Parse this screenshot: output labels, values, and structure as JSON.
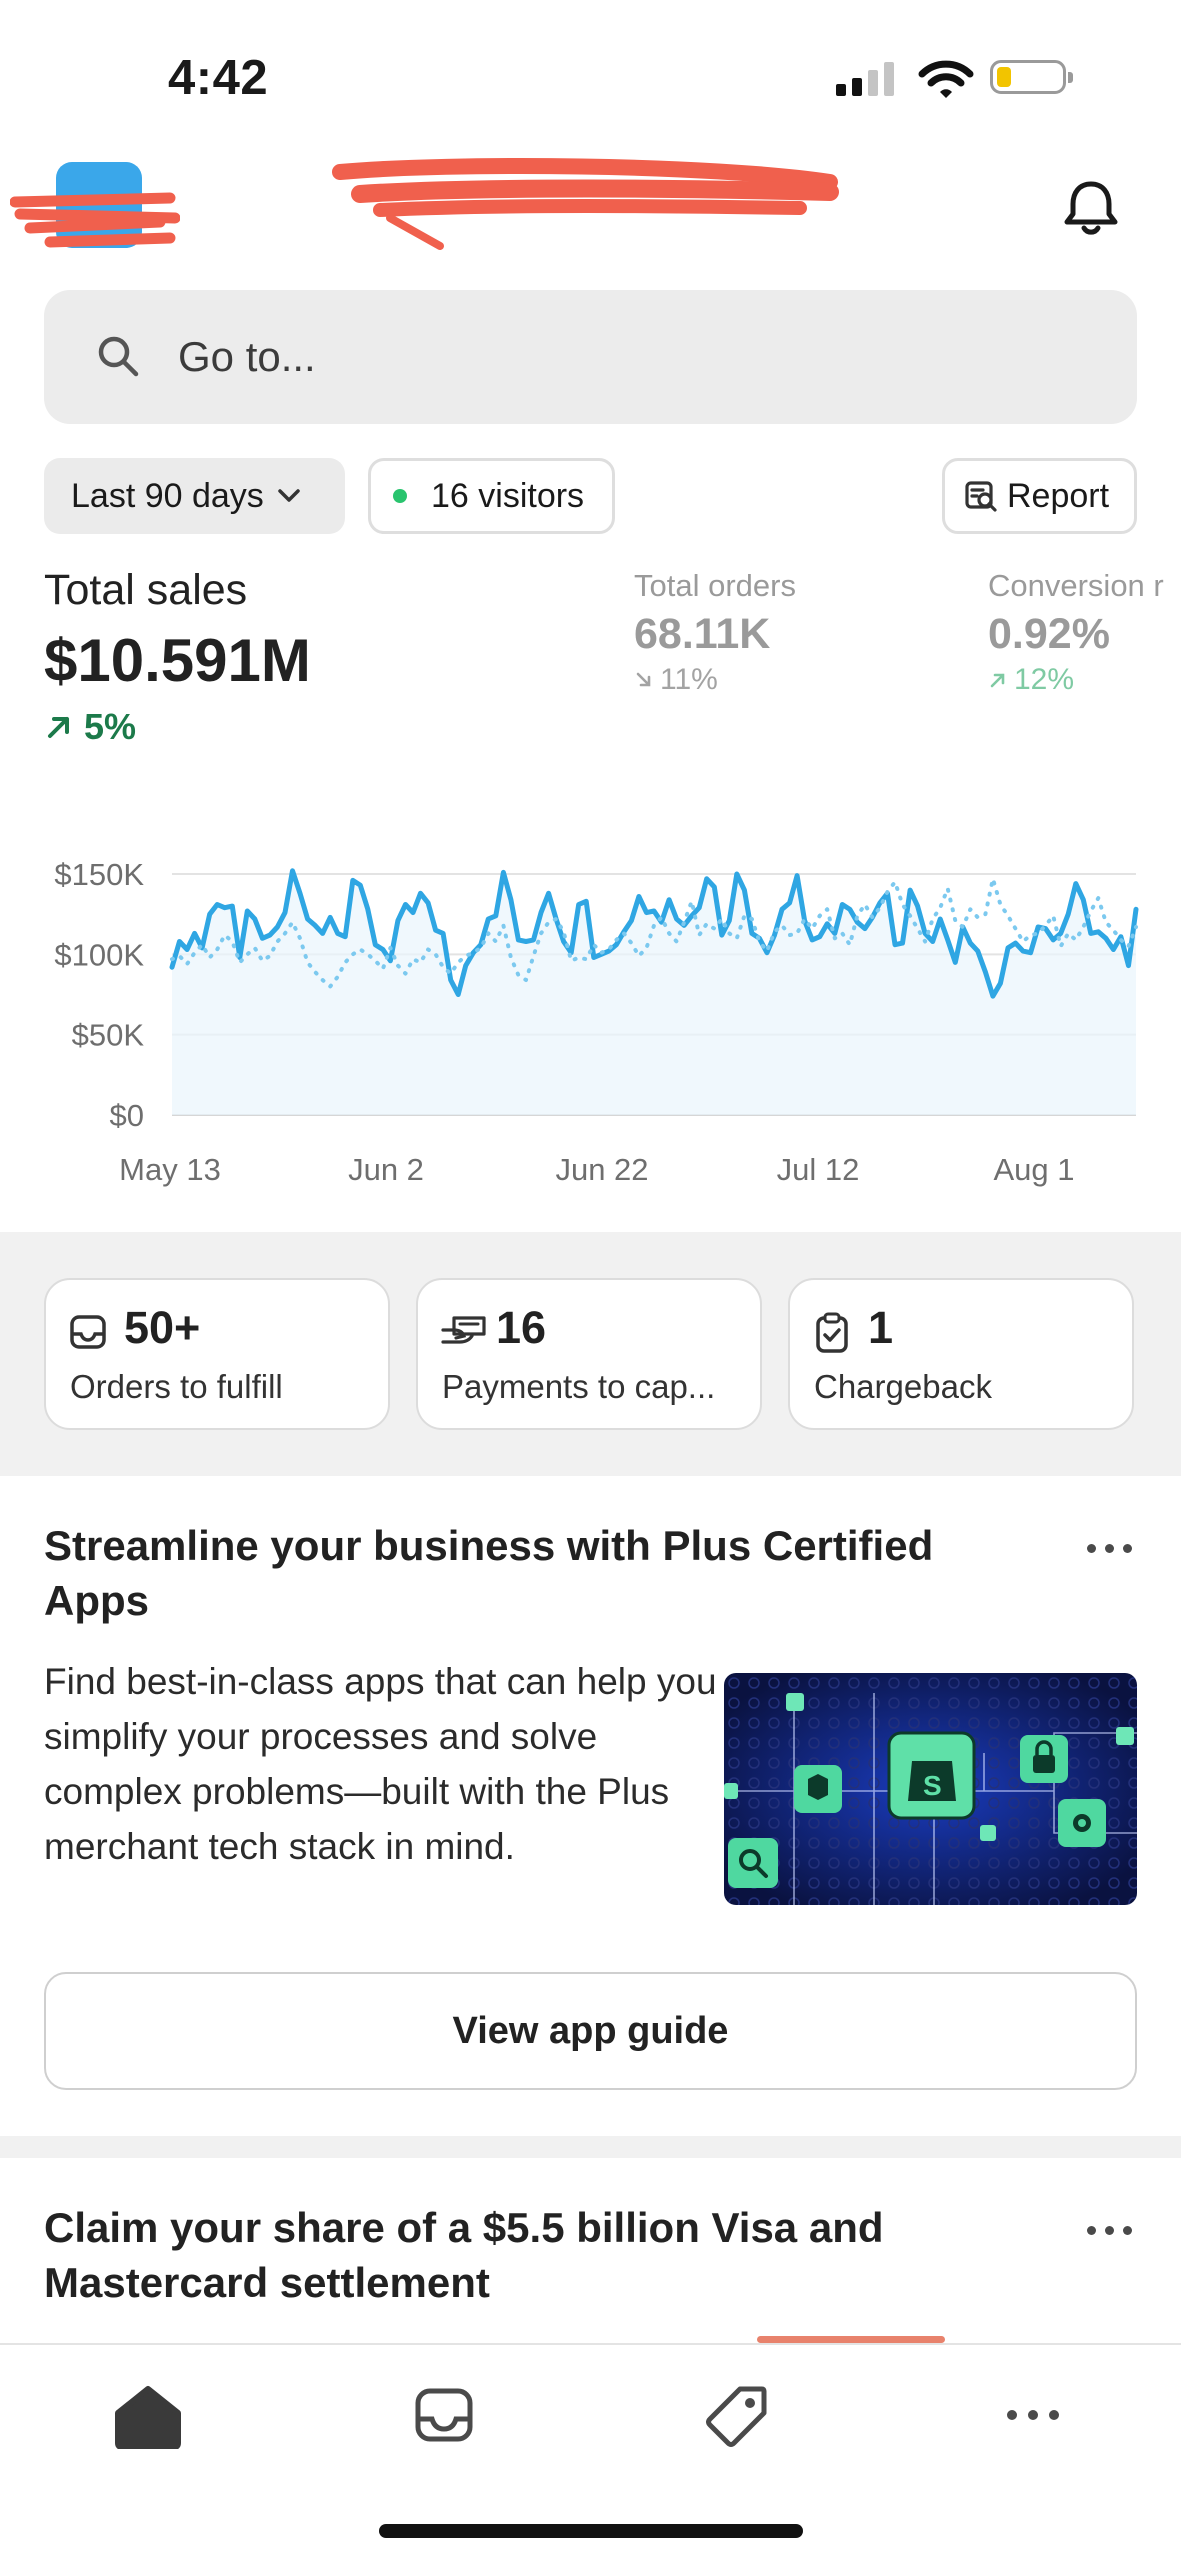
{
  "status_bar": {
    "time": "4:42"
  },
  "search": {
    "placeholder": "Go to..."
  },
  "filters": {
    "date_range": "Last 90 days",
    "visitors": "16 visitors",
    "report": "Report"
  },
  "metrics": {
    "total_sales": {
      "label": "Total sales",
      "value": "$10.591M",
      "change": "5%",
      "direction": "up"
    },
    "total_orders": {
      "label": "Total orders",
      "value": "68.11K",
      "change": "11%",
      "direction": "down"
    },
    "conversion": {
      "label": "Conversion r",
      "value": "0.92%",
      "change": "12%",
      "direction": "up"
    }
  },
  "chart_data": {
    "type": "line",
    "x_tick_labels": [
      "May 13",
      "Jun 2",
      "Jun 22",
      "Jul 12",
      "Aug 1"
    ],
    "y_tick_labels": [
      "$150K",
      "$100K",
      "$50K",
      "$0"
    ],
    "ylim": [
      0,
      150000
    ],
    "grid": true,
    "series": [
      {
        "style": "solid",
        "color": "#2fa6e3",
        "values": [
          92000,
          108000,
          103000,
          113000,
          104000,
          125000,
          131000,
          129000,
          130000,
          98000,
          127000,
          122000,
          110000,
          112000,
          117000,
          126000,
          152000,
          138000,
          122000,
          118000,
          113000,
          123000,
          113000,
          111000,
          146000,
          143000,
          128000,
          106000,
          103000,
          96000,
          121000,
          131000,
          126000,
          138000,
          132000,
          115000,
          113000,
          84000,
          75000,
          93000,
          101000,
          106000,
          122000,
          124000,
          151000,
          134000,
          109000,
          108000,
          109000,
          126000,
          138000,
          122000,
          108000,
          101000,
          131000,
          133000,
          98000,
          100000,
          102000,
          106000,
          114000,
          121000,
          136000,
          126000,
          127000,
          120000,
          134000,
          122000,
          118000,
          124000,
          129000,
          147000,
          142000,
          112000,
          121000,
          150000,
          140000,
          113000,
          110000,
          101000,
          112000,
          128000,
          132000,
          149000,
          121000,
          109000,
          111000,
          119000,
          113000,
          131000,
          128000,
          120000,
          116000,
          123000,
          132000,
          138000,
          106000,
          107000,
          140000,
          130000,
          113000,
          108000,
          122000,
          109000,
          95000,
          117000,
          107000,
          102000,
          89000,
          74000,
          82000,
          104000,
          107000,
          102000,
          101000,
          117000,
          116000,
          109000,
          113000,
          125000,
          144000,
          134000,
          113000,
          114000,
          110000,
          103000,
          111000,
          93000,
          128000
        ]
      },
      {
        "style": "dotted",
        "color": "#7cc9ef",
        "values": [
          97000,
          99000,
          94000,
          101000,
          106000,
          98000,
          103000,
          112000,
          108000,
          95000,
          100000,
          104000,
          96000,
          99000,
          108000,
          113000,
          120000,
          110000,
          95000,
          89000,
          84000,
          80000,
          86000,
          95000,
          100000,
          103000,
          100000,
          96000,
          91000,
          104000,
          93000,
          88000,
          97000,
          95000,
          103000,
          100000,
          92000,
          88000,
          95000,
          99000,
          101000,
          104000,
          113000,
          108000,
          118000,
          98000,
          87000,
          84000,
          99000,
          113000,
          120000,
          122000,
          114000,
          96000,
          98000,
          97000,
          106000,
          101000,
          103000,
          109000,
          113000,
          107000,
          99000,
          104000,
          118000,
          123000,
          113000,
          108000,
          120000,
          133000,
          112000,
          119000,
          116000,
          122000,
          113000,
          110000,
          124000,
          122000,
          108000,
          102000,
          114000,
          118000,
          112000,
          113000,
          122000,
          116000,
          124000,
          128000,
          110000,
          113000,
          106000,
          124000,
          131000,
          123000,
          129000,
          139000,
          145000,
          131000,
          124000,
          116000,
          108000,
          122000,
          129000,
          141000,
          121000,
          117000,
          128000,
          123000,
          125000,
          147000,
          131000,
          124000,
          116000,
          108000,
          112000,
          113000,
          118000,
          124000,
          105000,
          113000,
          109000,
          117000,
          127000,
          135000,
          120000,
          115000,
          109000,
          105000,
          117000
        ]
      }
    ]
  },
  "tasks": [
    {
      "icon": "inbox-icon",
      "count": "50+",
      "label": "Orders to fulfill"
    },
    {
      "icon": "payment-hand-icon",
      "count": "16",
      "label": "Payments to cap..."
    },
    {
      "icon": "clipboard-check-icon",
      "count": "1",
      "label": "Chargeback"
    }
  ],
  "cards": [
    {
      "title": "Streamline your business with Plus Certified Apps",
      "body": "Find best-in-class apps that can help you simplify your processes and solve complex problems—built with the Plus merchant tech stack in mind.",
      "cta": "View app guide"
    },
    {
      "title": "Claim your share of a $5.5 billion Visa and Mastercard settlement"
    }
  ],
  "nav": {
    "items": [
      "home-icon",
      "inbox-icon",
      "tag-icon",
      "more-icon"
    ]
  },
  "colors": {
    "accent_line": "#2fa6e3",
    "positive": "#1c7a4a",
    "redaction": "#f0604d"
  }
}
